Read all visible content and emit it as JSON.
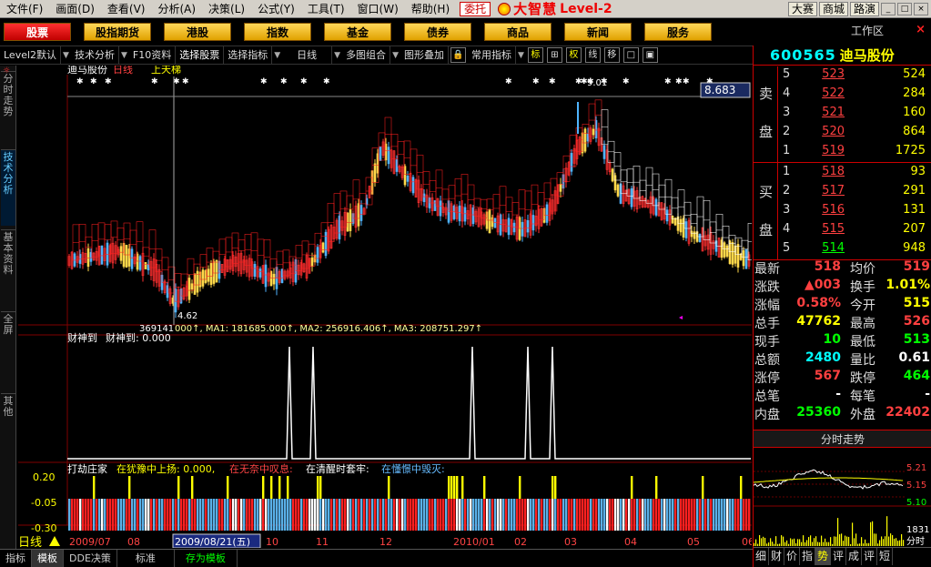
{
  "menu": {
    "items": [
      "文件(F)",
      "画面(D)",
      "查看(V)",
      "分析(A)",
      "决策(L)",
      "公式(Y)",
      "工具(T)",
      "窗口(W)",
      "帮助(H)"
    ],
    "weituo": "委托",
    "logo_cn": "大智慧",
    "logo_level": "Level-2",
    "top_right": [
      "大赛",
      "商城",
      "路演"
    ],
    "window_controls": [
      "_",
      "□",
      "×"
    ]
  },
  "categories": {
    "items": [
      "股票",
      "股指期货",
      "港股",
      "指数",
      "基金",
      "债券",
      "商品",
      "新闻",
      "服务"
    ],
    "active": "股票",
    "workzone": "工作区",
    "close": "×"
  },
  "toolbar": {
    "items": [
      "Level2默认",
      "技术分析",
      "F10资料",
      "选择股票",
      "选择指标",
      "日线",
      "多图组合",
      "图形叠加",
      "常用指标"
    ],
    "icons": [
      "标",
      "⊞",
      "权",
      "线",
      "移",
      "□",
      "▣"
    ]
  },
  "sidebar": {
    "tabs": [
      "分时走势",
      "技术分析",
      "基本资料",
      "全屏",
      "其他"
    ],
    "active": "技术分析"
  },
  "chart": {
    "stock_title": "迪马股份",
    "period": "日线",
    "pattern": "上天梯",
    "price_label": "8.683",
    "high_label": "9.01",
    "low_label": "4.62",
    "vol_label": "369141",
    "vol_ma": "000↑, MA1: 181685.000↑, MA2: 256916.406↑, MA3: 208751.297↑",
    "ind1_name": "财神到",
    "ind1_label": "财神到: 0.000",
    "ind2_name": "打劫庄家",
    "ind2_lines": [
      {
        "text": "在犹豫中上扬: 0.000,",
        "color": "#ffff00"
      },
      {
        "text": "在无奈中叹息:",
        "color": "#ff4040"
      },
      {
        "text": "在清醒时套牢:",
        "color": "#ffffff"
      },
      {
        "text": "在懂憬中毁灭:",
        "color": "#60b0ff"
      }
    ],
    "ind2_axis": [
      "0.20",
      "-0.05",
      "-0.30"
    ],
    "period_flag": "日线",
    "date_labels": [
      "2009/07",
      "08",
      "2009/08/21(五)",
      "10",
      "11",
      "12",
      "2010/01",
      "02",
      "03",
      "04",
      "05",
      "06"
    ],
    "cursor_date": "2009/08/21(五)"
  },
  "chart_data": {
    "type": "candlestick",
    "title": "迪马股份 日线",
    "high": 9.01,
    "low": 4.62,
    "current": 8.683,
    "date_range": [
      "2009/07",
      "2010/06"
    ]
  },
  "quote": {
    "code": "600565",
    "name": "迪马股份",
    "sell": [
      {
        "level": "5",
        "price": "523",
        "vol": "524"
      },
      {
        "level": "4",
        "price": "522",
        "vol": "284"
      },
      {
        "level": "3",
        "price": "521",
        "vol": "160"
      },
      {
        "level": "2",
        "price": "520",
        "vol": "864"
      },
      {
        "level": "1",
        "price": "519",
        "vol": "1725"
      }
    ],
    "buy": [
      {
        "level": "1",
        "price": "518",
        "vol": "93"
      },
      {
        "level": "2",
        "price": "517",
        "vol": "291"
      },
      {
        "level": "3",
        "price": "516",
        "vol": "131"
      },
      {
        "level": "4",
        "price": "515",
        "vol": "207"
      },
      {
        "level": "5",
        "price": "514",
        "vol": "948"
      }
    ],
    "sell_side_label": [
      "卖",
      "盘"
    ],
    "buy_side_label": [
      "买",
      "盘"
    ],
    "stats": [
      [
        "最新",
        "518",
        "均价",
        "519",
        "#ff4040",
        "#ff4040"
      ],
      [
        "涨跌",
        "▲003",
        "换手",
        "1.01%",
        "#ff4040",
        "#ffff00"
      ],
      [
        "涨幅",
        "0.58%",
        "今开",
        "515",
        "#ff4040",
        "#ffff00"
      ],
      [
        "总手",
        "47762",
        "最高",
        "526",
        "#ffff00",
        "#ff4040"
      ],
      [
        "现手",
        "10",
        "最低",
        "513",
        "#00ff00",
        "#00ff00"
      ],
      [
        "总额",
        "2480",
        "量比",
        "0.61",
        "#00ffff",
        "#ffffff"
      ],
      [
        "涨停",
        "567",
        "跌停",
        "464",
        "#ff4040",
        "#00ff00"
      ],
      [
        "总笔",
        "-",
        "每笔",
        "-",
        "#ffffff",
        "#ffffff"
      ],
      [
        "内盘",
        "25360",
        "外盘",
        "22402",
        "#00ff00",
        "#ff4040"
      ]
    ],
    "mini_title": "分时走势",
    "mini_axis": [
      "5.21",
      "5.15",
      "5.10"
    ],
    "mini_vol": "1831",
    "mini_vol_label": "分时",
    "right_tabs": [
      "细",
      "财",
      "价",
      "指",
      "势",
      "评",
      "成",
      "评",
      "短"
    ],
    "right_tab_active": "势"
  },
  "bottom": {
    "tabs": [
      "指标",
      "模板",
      "DDE决策",
      "标准",
      "存为模板"
    ]
  }
}
